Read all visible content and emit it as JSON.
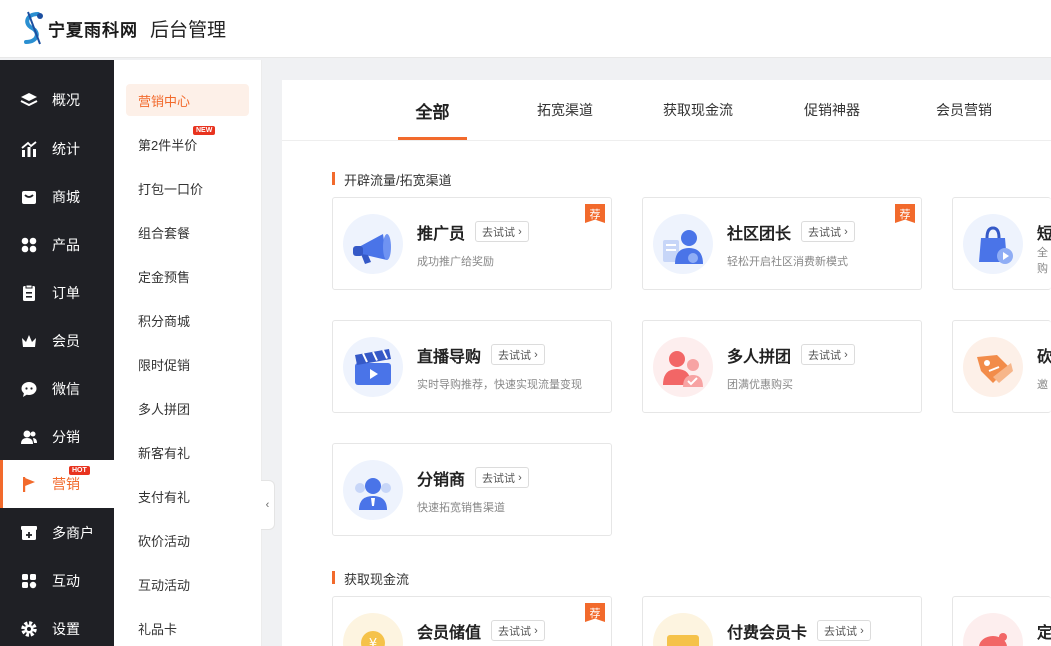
{
  "header": {
    "logo_text": "宁夏雨科网",
    "title": "后台管理"
  },
  "sidebar": {
    "items": [
      {
        "label": "概况",
        "icon": "layers-icon"
      },
      {
        "label": "统计",
        "icon": "chart-icon"
      },
      {
        "label": "商城",
        "icon": "shop-icon"
      },
      {
        "label": "产品",
        "icon": "grid-icon"
      },
      {
        "label": "订单",
        "icon": "order-icon"
      },
      {
        "label": "会员",
        "icon": "crown-icon"
      },
      {
        "label": "微信",
        "icon": "chat-icon"
      },
      {
        "label": "分销",
        "icon": "users-icon"
      },
      {
        "label": "营销",
        "icon": "flag-icon",
        "badge": "HOT",
        "active": true
      },
      {
        "label": "多商户",
        "icon": "store-plus-icon"
      },
      {
        "label": "互动",
        "icon": "interact-icon"
      },
      {
        "label": "设置",
        "icon": "gear-icon"
      }
    ]
  },
  "submenu": {
    "items": [
      {
        "label": "营销中心",
        "active": true
      },
      {
        "label": "第2件半价",
        "badge": "NEW"
      },
      {
        "label": "打包一口价"
      },
      {
        "label": "组合套餐"
      },
      {
        "label": "定金预售"
      },
      {
        "label": "积分商城"
      },
      {
        "label": "限时促销"
      },
      {
        "label": "多人拼团"
      },
      {
        "label": "新客有礼"
      },
      {
        "label": "支付有礼"
      },
      {
        "label": "砍价活动"
      },
      {
        "label": "互动活动"
      },
      {
        "label": "礼品卡"
      }
    ],
    "collapse_label": "‹"
  },
  "tabs": [
    {
      "label": "全部",
      "active": true
    },
    {
      "label": "拓宽渠道"
    },
    {
      "label": "获取现金流"
    },
    {
      "label": "促销神器"
    },
    {
      "label": "会员营销"
    }
  ],
  "sections": [
    {
      "title": "开辟流量/拓宽渠道",
      "cards": [
        {
          "name": "推广员",
          "try": "去试试",
          "desc": "成功推广给奖励",
          "rec": "荐",
          "icon": "megaphone-icon"
        },
        {
          "name": "社区团长",
          "try": "去试试",
          "desc": "轻松开启社区消费新模式",
          "rec": "荐",
          "icon": "community-leader-icon"
        },
        {
          "name": "短",
          "try": "",
          "desc": "全",
          "desc2": "购",
          "icon": "shopping-bag-video-icon"
        },
        {
          "name": "直播导购",
          "try": "去试试",
          "desc": "实时导购推荐，快速实现流量变现",
          "icon": "clapperboard-icon"
        },
        {
          "name": "多人拼团",
          "try": "去试试",
          "desc": "团满优惠购买",
          "icon": "group-buy-icon"
        },
        {
          "name": "砍",
          "try": "",
          "desc": "邀",
          "icon": "price-tag-icon"
        },
        {
          "name": "分销商",
          "try": "去试试",
          "desc": "快速拓宽销售渠道",
          "icon": "distributor-icon"
        }
      ]
    },
    {
      "title": "获取现金流",
      "cards": [
        {
          "name": "会员储值",
          "try": "去试试",
          "rec": "荐",
          "icon": "coin-icon"
        },
        {
          "name": "付费会员卡",
          "try": "去试试",
          "icon": "member-card-icon"
        },
        {
          "name": "定",
          "try": "",
          "icon": "piggy-icon"
        }
      ]
    }
  ],
  "colors": {
    "accent": "#f26a2c",
    "sidebar_bg": "#1f2025",
    "icon_blue": "#4a74e8",
    "badge_red": "#e8331f"
  }
}
